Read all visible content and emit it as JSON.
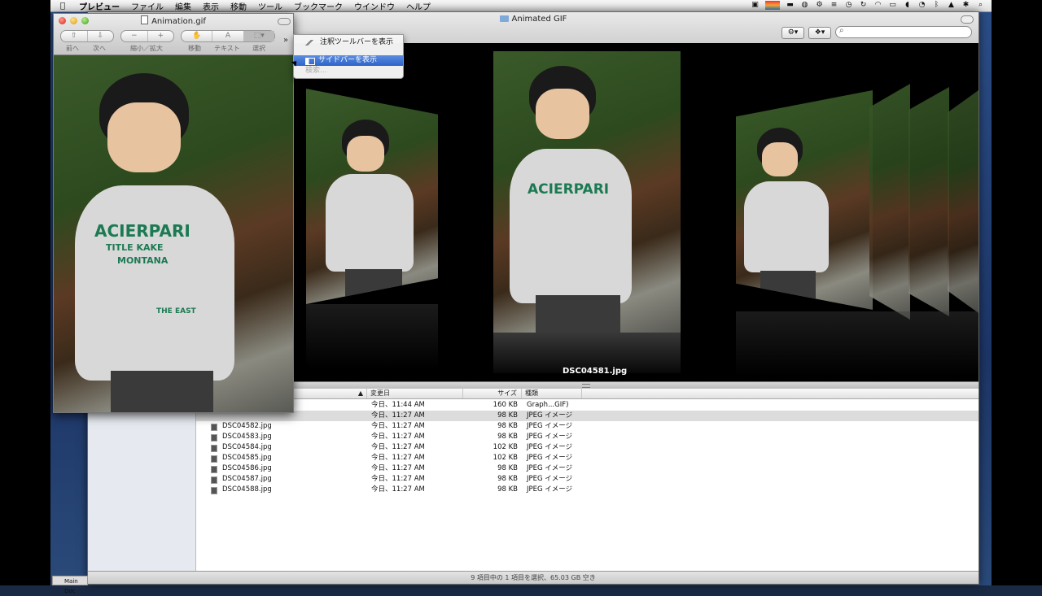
{
  "menubar": {
    "app_name": "プレビュー",
    "items": [
      "ファイル",
      "編集",
      "表示",
      "移動",
      "ツール",
      "ブックマーク",
      "ウインドウ",
      "ヘルプ"
    ]
  },
  "finder": {
    "title": "Animated GIF",
    "coverflow_caption": "DSC04581.jpg",
    "columns": {
      "name": "",
      "modified": "変更日",
      "size": "サイズ",
      "kind": "種類"
    },
    "rows": [
      {
        "name": "",
        "date": "今日、11:44 AM",
        "size": "160 KB",
        "kind": "Graph...GIF)"
      },
      {
        "name": "",
        "date": "今日、11:27 AM",
        "size": "98 KB",
        "kind": "JPEG イメージ"
      },
      {
        "name": "DSC04582.jpg",
        "date": "今日、11:27 AM",
        "size": "98 KB",
        "kind": "JPEG イメージ"
      },
      {
        "name": "DSC04583.jpg",
        "date": "今日、11:27 AM",
        "size": "98 KB",
        "kind": "JPEG イメージ"
      },
      {
        "name": "DSC04584.jpg",
        "date": "今日、11:27 AM",
        "size": "102 KB",
        "kind": "JPEG イメージ"
      },
      {
        "name": "DSC04585.jpg",
        "date": "今日、11:27 AM",
        "size": "102 KB",
        "kind": "JPEG イメージ"
      },
      {
        "name": "DSC04586.jpg",
        "date": "今日、11:27 AM",
        "size": "98 KB",
        "kind": "JPEG イメージ"
      },
      {
        "name": "DSC04587.jpg",
        "date": "今日、11:27 AM",
        "size": "98 KB",
        "kind": "JPEG イメージ"
      },
      {
        "name": "DSC04588.jpg",
        "date": "今日、11:27 AM",
        "size": "98 KB",
        "kind": "JPEG イメージ"
      }
    ],
    "status": "9 項目中の 1 項目を選択、65.03 GB 空き"
  },
  "preview": {
    "title": "Animation.gif",
    "toolbar_labels": {
      "prev": "前へ",
      "next": "次へ",
      "zoom": "縮小／拡大",
      "move": "移動",
      "text": "テキスト",
      "select": "選択"
    },
    "photo_print": {
      "line1": "ACIERPARI",
      "line2": "TITLE KAKE",
      "line3": "MONTANA",
      "line4": "THE EAST"
    }
  },
  "dropdown": {
    "items": [
      "注釈ツールバーを表示",
      "サイドバーを表示",
      "検索..."
    ]
  },
  "dock": {
    "label": "Main Doc"
  }
}
